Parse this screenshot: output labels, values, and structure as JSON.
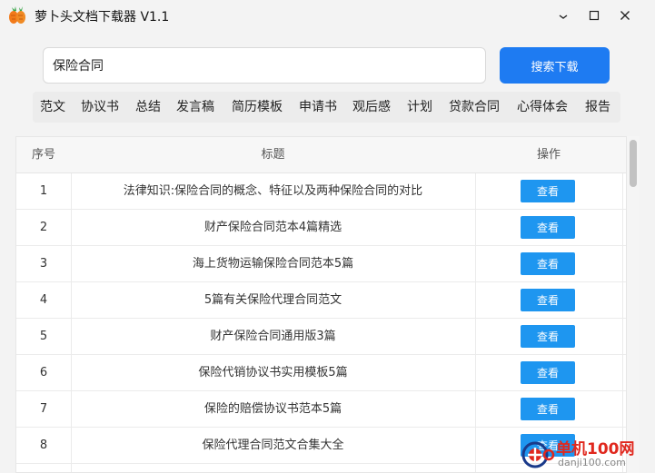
{
  "window": {
    "title": "萝卜头文档下载器 V1.1",
    "icons": [
      "carrot-app-icon",
      "minimize-icon",
      "maximize-icon",
      "close-icon"
    ]
  },
  "search": {
    "value": "保险合同",
    "button_label": "搜索下载"
  },
  "categories": [
    "范文",
    "协议书",
    "总结",
    "发言稿",
    "简历模板",
    "申请书",
    "观后感",
    "计划",
    "贷款合同",
    "心得体会",
    "报告"
  ],
  "table": {
    "headers": {
      "index": "序号",
      "title": "标题",
      "action": "操作"
    },
    "rows": [
      {
        "index": "1",
        "title": "法律知识:保险合同的概念、特征以及两种保险合同的对比",
        "action": "查看"
      },
      {
        "index": "2",
        "title": "财产保险合同范本4篇精选",
        "action": "查看"
      },
      {
        "index": "3",
        "title": "海上货物运输保险合同范本5篇",
        "action": "查看"
      },
      {
        "index": "4",
        "title": "5篇有关保险代理合同范文",
        "action": "查看"
      },
      {
        "index": "5",
        "title": "财产保险合同通用版3篇",
        "action": "查看"
      },
      {
        "index": "6",
        "title": "保险代销协议书实用模板5篇",
        "action": "查看"
      },
      {
        "index": "7",
        "title": "保险的赔偿协议书范本5篇",
        "action": "查看"
      },
      {
        "index": "8",
        "title": "保险代理合同范文合集大全",
        "action": "查看"
      }
    ]
  },
  "watermark": {
    "line1": "单机100网",
    "line2": "danji100.com"
  },
  "colors": {
    "primary_button": "#1e7bf2",
    "view_button": "#1e96f0",
    "watermark_red": "#e0281e"
  }
}
